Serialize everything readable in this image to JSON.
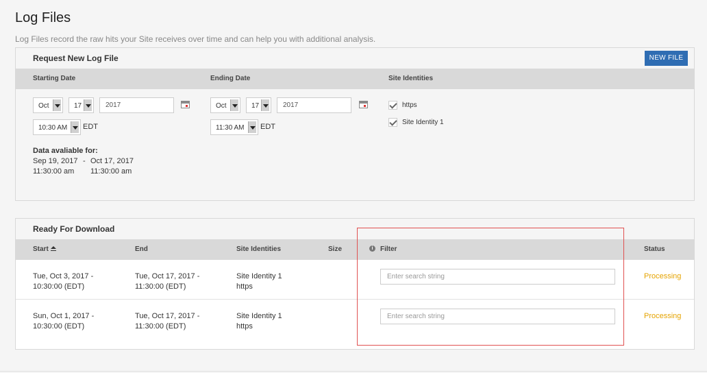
{
  "page": {
    "title": "Log Files",
    "description": "Log Files record the raw hits your Site receives over time and can help you with additional analysis."
  },
  "request_panel": {
    "title": "Request New Log File",
    "new_file_label": "NEW FILE",
    "starting_date_label": "Starting Date",
    "ending_date_label": "Ending Date",
    "site_identities_label": "Site Identities",
    "start": {
      "month": "Oct",
      "day": "17",
      "year": "2017",
      "time": "10:30 AM",
      "tz": "EDT"
    },
    "end": {
      "month": "Oct",
      "day": "17",
      "year": "2017",
      "time": "11:30 AM",
      "tz": "EDT"
    },
    "identities": [
      {
        "label": "https",
        "checked": true
      },
      {
        "label": "Site Identity 1",
        "checked": true
      }
    ],
    "availability": {
      "label": "Data avaliable for:",
      "from_date": "Sep 19, 2017",
      "separator": "-",
      "to_date": "Oct 17, 2017",
      "from_time": "11:30:00 am",
      "to_time": "11:30:00 am"
    }
  },
  "download_panel": {
    "title": "Ready For Download",
    "columns": {
      "start": "Start",
      "end": "End",
      "site_identities": "Site Identities",
      "size": "Size",
      "filter": "Filter",
      "status": "Status"
    },
    "rows": [
      {
        "start_line1": "Tue, Oct 3, 2017 -",
        "start_line2": "10:30:00 (EDT)",
        "end_line1": "Tue, Oct 17, 2017 -",
        "end_line2": "11:30:00 (EDT)",
        "identity1": "Site Identity 1",
        "identity2": "https",
        "size": "",
        "filter_placeholder": "Enter search string",
        "status": "Processing"
      },
      {
        "start_line1": "Sun, Oct 1, 2017 -",
        "start_line2": "10:30:00 (EDT)",
        "end_line1": "Tue, Oct 17, 2017 -",
        "end_line2": "11:30:00 (EDT)",
        "identity1": "Site Identity 1",
        "identity2": "https",
        "size": "",
        "filter_placeholder": "Enter search string",
        "status": "Processing"
      }
    ]
  },
  "colors": {
    "accent": "#2f6db3",
    "status_processing": "#e5a300",
    "highlight_border": "#e05050"
  },
  "icons": [
    "calendar-icon",
    "checkmark-icon",
    "sort-ascending-icon",
    "info-icon",
    "dropdown-arrow-icon"
  ]
}
